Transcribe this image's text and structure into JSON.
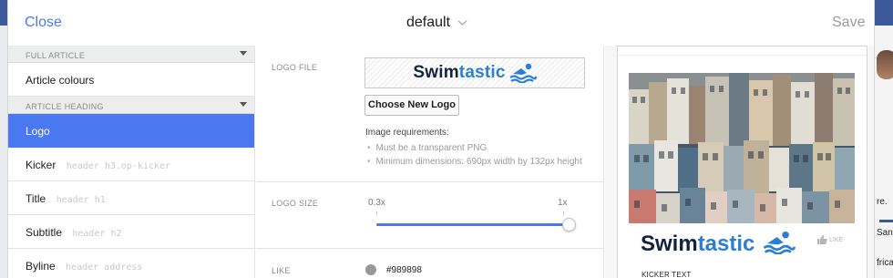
{
  "header": {
    "close_label": "Close",
    "title": "default",
    "save_label": "Save"
  },
  "sidebar": {
    "sections": [
      {
        "heading": "FULL ARTICLE",
        "items": [
          {
            "label": "Article colours",
            "hint": ""
          }
        ]
      },
      {
        "heading": "ARTICLE HEADING",
        "items": [
          {
            "label": "Logo",
            "hint": ""
          },
          {
            "label": "Kicker",
            "hint": "header h3.op-kicker"
          },
          {
            "label": "Title",
            "hint": "header h1"
          },
          {
            "label": "Subtitle",
            "hint": "header h2"
          },
          {
            "label": "Byline",
            "hint": "header address"
          }
        ]
      }
    ],
    "active_item": "Logo"
  },
  "settings": {
    "logo_file": {
      "label": "LOGO FILE",
      "logo_text_part1": "Swim",
      "logo_text_accent": "tastic",
      "button_label": "Choose New Logo",
      "requirements_title": "Image requirements:",
      "requirements": [
        "Must be a transparent PNG",
        "Minimum dimensions: 690px width by 132px height"
      ]
    },
    "logo_size": {
      "label": "LOGO SIZE",
      "min_label": "0.3x",
      "max_label": "1x",
      "value_fraction": 1.0
    },
    "like": {
      "label": "LIKE",
      "color": "#989898",
      "value_text": "#989898"
    }
  },
  "preview": {
    "logo_text_part1": "Swim",
    "logo_text_accent": "tastic",
    "like_label": "LIKE",
    "kicker_text": "KICKER TEXT"
  },
  "background": {
    "snippets": [
      "re.",
      "San",
      "frica"
    ]
  },
  "colors": {
    "accent": "#4a78f0",
    "logo_dark": "#13233e",
    "logo_blue": "#2a7fd4"
  }
}
